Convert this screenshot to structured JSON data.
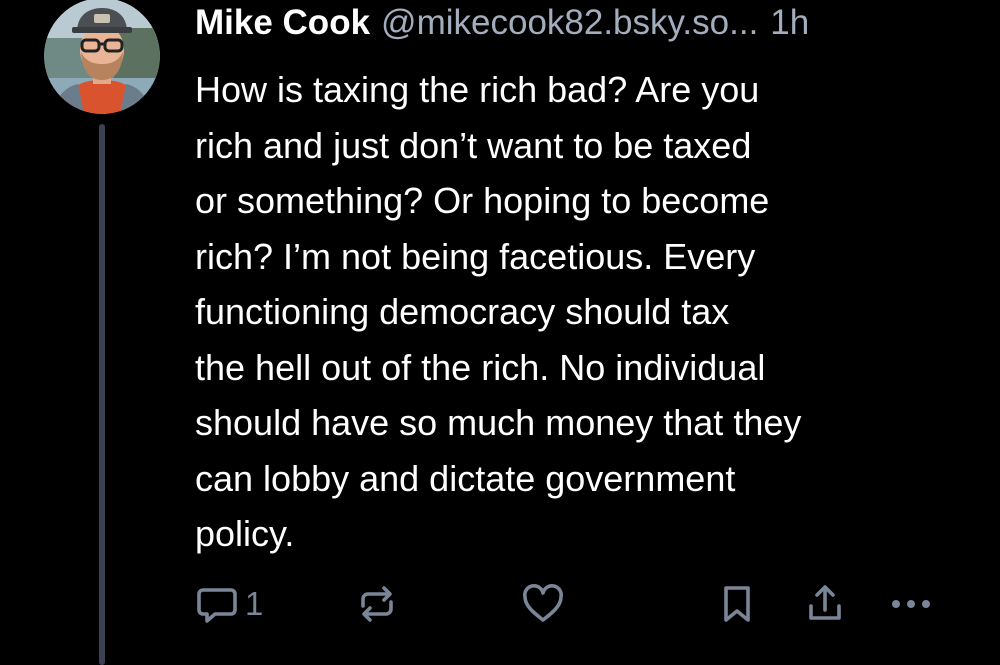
{
  "post": {
    "author_name": "Mike Cook",
    "author_handle": "@mikecook82.bsky.so...",
    "time": "1h",
    "text_lines": [
      "How is taxing the rich bad? Are you",
      "rich and just don’t want to be taxed",
      "or something? Or hoping to become",
      "rich? I’m not being facetious. Every",
      "functioning democracy should tax",
      "the hell out of the rich. No individual",
      "should have so much money that they",
      "can lobby and dictate government",
      "policy."
    ],
    "reply_count": "1"
  },
  "icons": {
    "reply": "speech-bubble-icon",
    "repost": "repost-arrows-icon",
    "like": "heart-icon",
    "bookmark": "bookmark-icon",
    "share": "share-upload-icon",
    "more": "ellipsis-icon"
  },
  "colors": {
    "background": "#000000",
    "text": "#ffffff",
    "muted": "#a3adbd",
    "icon": "#7a8597",
    "thread_line": "#3a4250"
  }
}
